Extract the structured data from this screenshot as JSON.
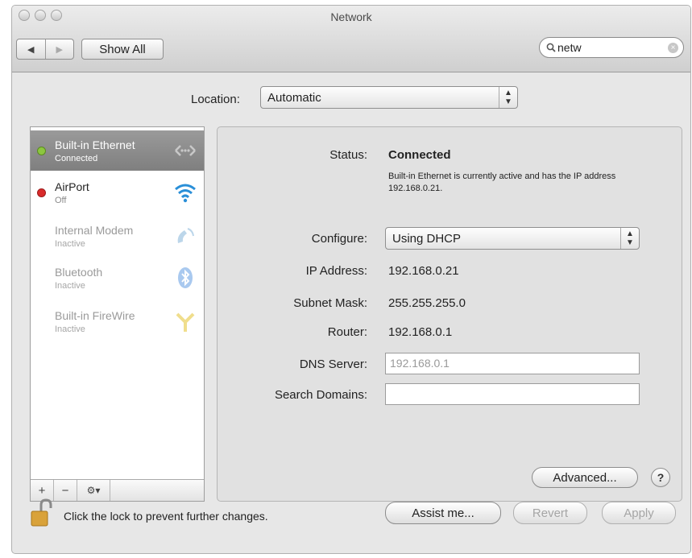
{
  "window": {
    "title": "Network"
  },
  "toolbar": {
    "back_glyph": "◀",
    "forward_glyph": "▶",
    "show_all_label": "Show All",
    "search_value": "netw"
  },
  "location": {
    "label": "Location:",
    "value": "Automatic"
  },
  "services": [
    {
      "name": "Built-in Ethernet",
      "status": "Connected",
      "indicator": "#8cc63f",
      "icon": "ethernet-icon",
      "state": "selected"
    },
    {
      "name": "AirPort",
      "status": "Off",
      "indicator": "#d92b2b",
      "icon": "wifi-icon",
      "state": "normal"
    },
    {
      "name": "Internal Modem",
      "status": "Inactive",
      "icon": "phone-icon",
      "state": "inactive"
    },
    {
      "name": "Bluetooth",
      "status": "Inactive",
      "icon": "bluetooth-icon",
      "state": "inactive"
    },
    {
      "name": "Built-in FireWire",
      "status": "Inactive",
      "icon": "firewire-icon",
      "state": "inactive"
    }
  ],
  "sidebar_footer": {
    "add": "+",
    "remove": "−",
    "action": "⚙▾"
  },
  "detail": {
    "status_label": "Status:",
    "status_value": "Connected",
    "status_description": "Built-in Ethernet is currently active and has the IP address 192.168.0.21.",
    "configure_label": "Configure:",
    "configure_value": "Using DHCP",
    "ip_label": "IP Address:",
    "ip_value": "192.168.0.21",
    "subnet_label": "Subnet Mask:",
    "subnet_value": "255.255.255.0",
    "router_label": "Router:",
    "router_value": "192.168.0.1",
    "dns_label": "DNS Server:",
    "dns_value": "192.168.0.1",
    "search_domains_label": "Search Domains:",
    "search_domains_value": "",
    "advanced_label": "Advanced...",
    "help_label": "?"
  },
  "footer": {
    "lock_text": "Click the lock to prevent further changes.",
    "assist_label": "Assist me...",
    "revert_label": "Revert",
    "apply_label": "Apply"
  }
}
